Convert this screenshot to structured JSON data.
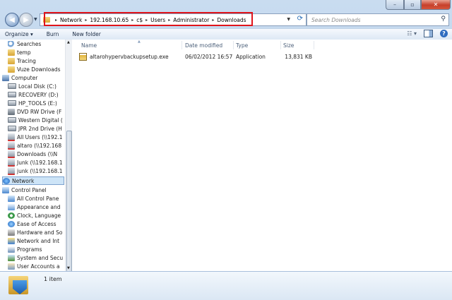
{
  "window": {
    "minimize_glyph": "–",
    "maximize_glyph": "▫",
    "close_glyph": "✕"
  },
  "address": {
    "crumbs": [
      "Network",
      "192.168.10.65",
      "c$",
      "Users",
      "Administrator",
      "Downloads"
    ],
    "separator": "▸"
  },
  "search": {
    "placeholder": "Search Downloads"
  },
  "toolbar": {
    "organize": "Organize ▾",
    "burn": "Burn",
    "new_folder": "New folder"
  },
  "nav": {
    "items": [
      {
        "label": "Searches",
        "icon": "search-folder-icon"
      },
      {
        "label": "temp",
        "icon": "folder-icon"
      },
      {
        "label": "Tracing",
        "icon": "folder-icon"
      },
      {
        "label": "Vuze Downloads",
        "icon": "folder-icon"
      },
      {
        "label": "Computer",
        "icon": "computer-icon"
      },
      {
        "label": "Local Disk (C:)",
        "icon": "drive-icon"
      },
      {
        "label": "RECOVERY (D:)",
        "icon": "drive-icon"
      },
      {
        "label": "HP_TOOLS (E:)",
        "icon": "drive-icon"
      },
      {
        "label": "DVD RW Drive (F",
        "icon": "dvd-icon"
      },
      {
        "label": "Western Digital (",
        "icon": "drive-icon"
      },
      {
        "label": "JPR 2nd Drive (H",
        "icon": "drive-icon"
      },
      {
        "label": "All Users (\\\\192.1",
        "icon": "network-drive-icon"
      },
      {
        "label": "altaro (\\\\192.168",
        "icon": "network-drive-icon"
      },
      {
        "label": "Downloads (\\\\N",
        "icon": "network-drive-icon"
      },
      {
        "label": "Junk (\\\\192.168.1",
        "icon": "network-drive-icon"
      },
      {
        "label": "junk (\\\\192.168.1",
        "icon": "network-drive-icon"
      },
      {
        "label": "Network",
        "icon": "network-icon"
      },
      {
        "label": "Control Panel",
        "icon": "control-panel-icon"
      },
      {
        "label": "All Control Pane",
        "icon": "control-panel-icon"
      },
      {
        "label": "Appearance and",
        "icon": "appearance-icon"
      },
      {
        "label": "Clock, Language",
        "icon": "clock-icon"
      },
      {
        "label": "Ease of Access",
        "icon": "ease-of-access-icon"
      },
      {
        "label": "Hardware and So",
        "icon": "hardware-icon"
      },
      {
        "label": "Network and Int",
        "icon": "network-internet-icon"
      },
      {
        "label": "Programs",
        "icon": "programs-icon"
      },
      {
        "label": "System and Secu",
        "icon": "system-security-icon"
      },
      {
        "label": "User Accounts a",
        "icon": "user-accounts-icon"
      }
    ]
  },
  "columns": {
    "name": "Name",
    "date": "Date modified",
    "type": "Type",
    "size": "Size"
  },
  "files": [
    {
      "name": "altarohypervbackupsetup.exe",
      "date": "06/02/2012 16:57",
      "type": "Application",
      "size": "13,831 KB"
    }
  ],
  "status": {
    "count": "1 item"
  },
  "colors": {
    "highlight_box": "#e0141b",
    "selection": "#cde4f7"
  }
}
